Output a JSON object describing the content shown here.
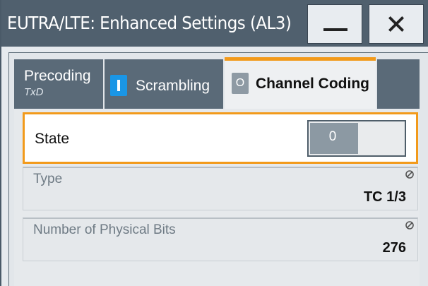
{
  "window": {
    "title": "EUTRA/LTE: Enhanced Settings (AL3)",
    "min_icon": "minimize-icon",
    "close_icon": "close-icon"
  },
  "tabs": [
    {
      "label": "Precoding",
      "sub": "TxD",
      "active": false
    },
    {
      "label": "Scrambling",
      "indicator": "on",
      "active": false
    },
    {
      "label": "Channel Coding",
      "indicator": "off",
      "indicator_text": "O",
      "active": true
    },
    {
      "label": "",
      "active": false
    }
  ],
  "state": {
    "label": "State",
    "value": "0"
  },
  "type": {
    "label": "Type",
    "value": "TC 1/3"
  },
  "bits": {
    "label": "Number of Physical Bits",
    "value": "276"
  },
  "colors": {
    "accent": "#f29a1b",
    "header": "#50606e",
    "on_indicator": "#1a96e6"
  }
}
